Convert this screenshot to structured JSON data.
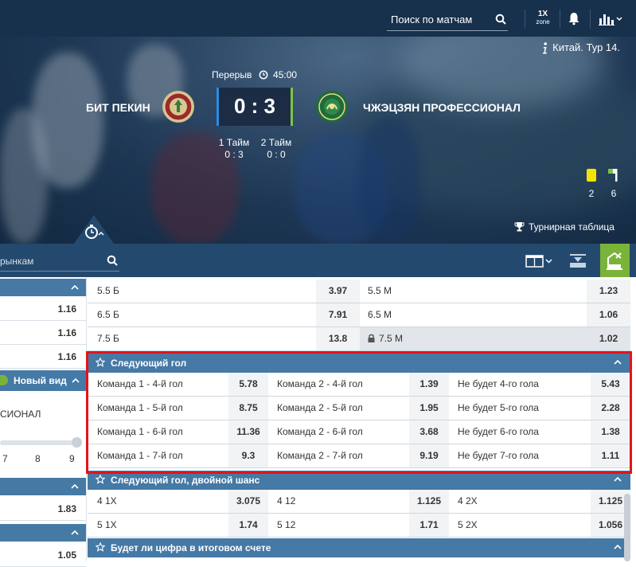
{
  "header": {
    "search_placeholder": "Поиск по матчам",
    "zone_top": "1X",
    "zone_bottom": "zone"
  },
  "match": {
    "league": "Китай. Тур 14.",
    "status": "Перерыв",
    "time": "45:00",
    "team1": "БИТ ПЕКИН",
    "team2": "ЧЖЭЦЗЯН ПРОФЕССИОНАЛ",
    "score": "0 : 3",
    "half1_label": "1 Тайм",
    "half1_score": "0 : 3",
    "half2_label": "2 Тайм",
    "half2_score": "0 : 0",
    "yellow_cards": "2",
    "corners": "6",
    "standings_link": "Турнирная таблица",
    "colors": {
      "yellow_card": "#f5e200",
      "accent_green": "#7bb33a",
      "highlight": "#e3131b"
    }
  },
  "toolbar": {
    "market_search": "рынкам"
  },
  "left": {
    "odds_top": [
      "1.16",
      "1.16",
      "1.16"
    ],
    "new_view_label": "Новый вид",
    "team_fragment": "СИОНАЛ",
    "scale": [
      "7",
      "8",
      "9"
    ],
    "odds_mid": "1.83",
    "odds_bottom": "1.05"
  },
  "markets": {
    "total_rows": [
      {
        "l1": "5.5 Б",
        "v1": "3.97",
        "l2": "5.5 М",
        "v2": "1.23"
      },
      {
        "l1": "6.5 Б",
        "v1": "7.91",
        "l2": "6.5 М",
        "v2": "1.06"
      },
      {
        "l1": "7.5 Б",
        "v1": "13.8",
        "l2": "7.5 М",
        "v2": "1.02"
      }
    ],
    "next_goal": {
      "title": "Следующий гол",
      "rows": [
        {
          "a": "Команда 1 - 4-й гол",
          "av": "5.78",
          "b": "Команда 2 - 4-й гол",
          "bv": "1.39",
          "c": "Не будет 4-го гола",
          "cv": "5.43"
        },
        {
          "a": "Команда 1 - 5-й гол",
          "av": "8.75",
          "b": "Команда 2 - 5-й гол",
          "bv": "1.95",
          "c": "Не будет 5-го гола",
          "cv": "2.28"
        },
        {
          "a": "Команда 1 - 6-й гол",
          "av": "11.36",
          "b": "Команда 2 - 6-й гол",
          "bv": "3.68",
          "c": "Не будет 6-го гола",
          "cv": "1.38"
        },
        {
          "a": "Команда 1 - 7-й гол",
          "av": "9.3",
          "b": "Команда 2 - 7-й гол",
          "bv": "9.19",
          "c": "Не будет 7-го гола",
          "cv": "1.11"
        }
      ]
    },
    "double_chance": {
      "title": "Следующий гол, двойной шанс",
      "rows": [
        {
          "a": "4 1X",
          "av": "3.075",
          "b": "4 12",
          "bv": "1.125",
          "c": "4 2X",
          "cv": "1.125"
        },
        {
          "a": "5 1X",
          "av": "1.74",
          "b": "5 12",
          "bv": "1.71",
          "c": "5 2X",
          "cv": "1.056"
        }
      ]
    },
    "digit_title": "Будет ли цифра в итоговом счете"
  }
}
